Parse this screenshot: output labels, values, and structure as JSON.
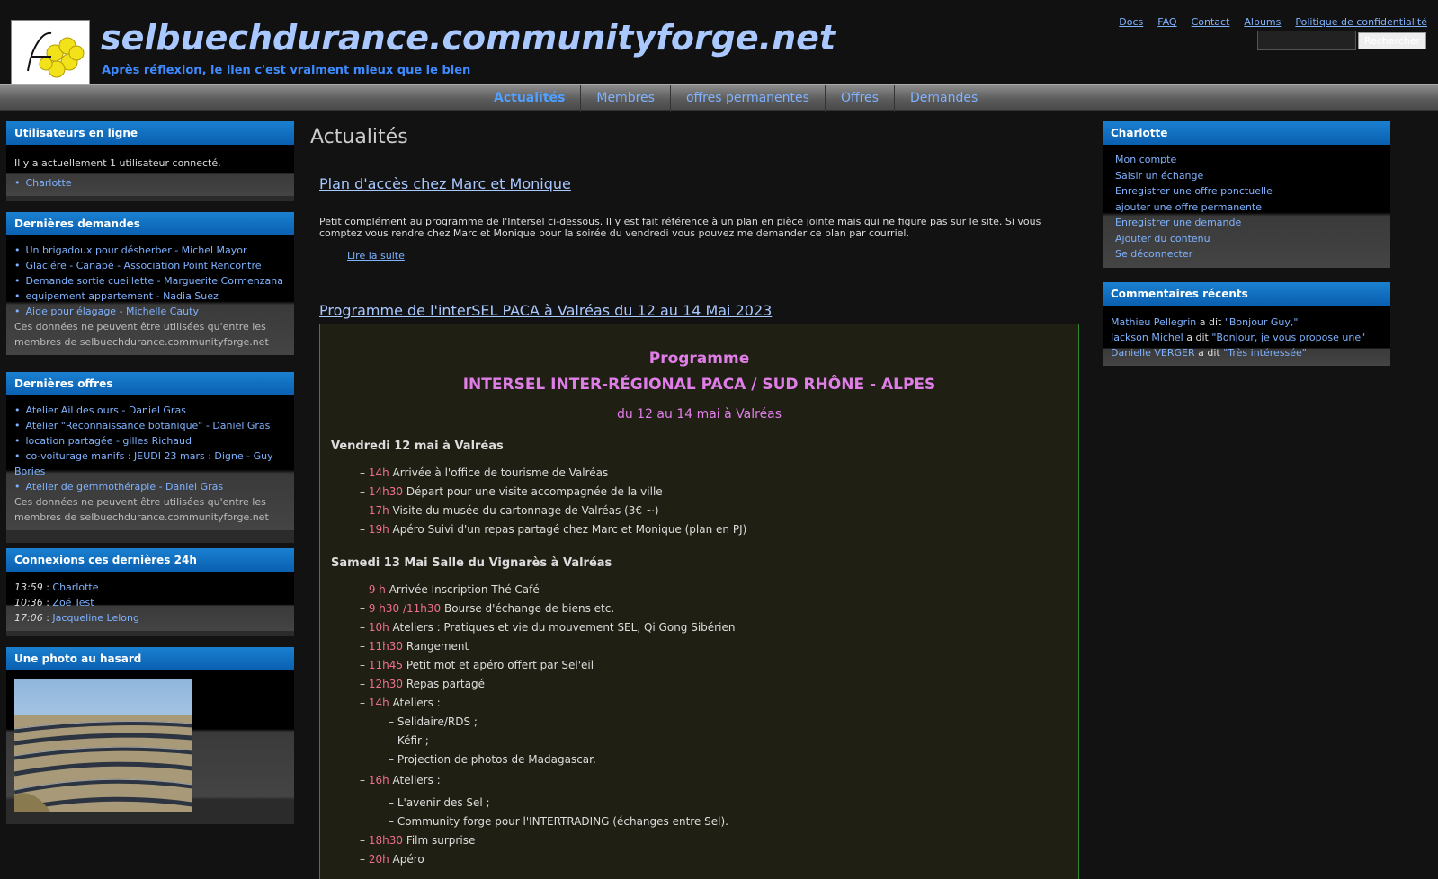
{
  "header": {
    "site_name": "selbuechdurance.communityforge.net",
    "slogan": "Après réflexion, le lien c'est vraiment mieux que le bien",
    "top_links": [
      "Docs",
      "FAQ",
      "Contact",
      "Albums",
      "Politique de confidentialité"
    ],
    "search_button": "Rechercher",
    "search_value": ""
  },
  "nav": {
    "items": [
      "Actualités",
      "Membres",
      "offres permanentes",
      "Offres",
      "Demandes"
    ],
    "active": "Actualités"
  },
  "left": {
    "online": {
      "title": "Utilisateurs en ligne",
      "text": "Il y a actuellement 1 utilisateur connecté.",
      "users": [
        "Charlotte"
      ]
    },
    "demands": {
      "title": "Dernières demandes",
      "items": [
        "Un brigadoux pour désherber - Michel Mayor",
        "Glaciére - Canapé - Association Point Rencontre",
        "Demande sortie cueillette - Marguerite Cormenzana",
        "equipement appartement - Nadia Suez",
        "Aide pour élagage - Michelle Cauty"
      ],
      "note": "Ces données ne peuvent être utilisées qu'entre les membres de selbuechdurance.communityforge.net"
    },
    "offers": {
      "title": "Dernières offres",
      "items": [
        "Atelier Ail des ours - Daniel Gras",
        "Atelier \"Reconnaissance botanique\" - Daniel Gras",
        "location partagée - gilles Richaud",
        "co-voiturage manifs : JEUDI 23 mars : Digne - Guy Bories",
        "Atelier de gemmothérapie - Daniel Gras"
      ],
      "note": "Ces données ne peuvent être utilisées qu'entre les membres de selbuechdurance.communityforge.net"
    },
    "connections": {
      "title": "Connexions ces dernières 24h",
      "items": [
        {
          "time": "13:59",
          "name": "Charlotte"
        },
        {
          "time": "10:36",
          "name": "Zoé Test"
        },
        {
          "time": "17:06",
          "name": "Jacqueline Lelong"
        }
      ]
    },
    "photo": {
      "title": "Une photo au hasard"
    }
  },
  "main": {
    "page_title": "Actualités",
    "node1": {
      "title": "Plan d'accès chez Marc et Monique",
      "teaser": "Petit complément au programme de l'Intersel ci-dessous. Il y est fait référence à un plan en pièce jointe mais qui ne figure pas sur le site. Si vous comptez vous rendre chez Marc et Monique pour la soirée du vendredi vous pouvez me demander ce plan par courriel.",
      "read_more": "Lire la suite"
    },
    "node2": {
      "title": "Programme de l'interSEL PACA à Valréas du 12 au 14 Mai 2023"
    },
    "programme": {
      "h1": "Programme",
      "h2": "INTERSEL INTER-RÉGIONAL PACA / SUD RHÔNE - ALPES",
      "h3": "du 12 au 14 mai à Valréas",
      "day1": {
        "title": "Vendredi 12 mai à Valréas",
        "items": [
          {
            "t": "14h",
            "d": "Arrivée à l'office de tourisme de Valréas"
          },
          {
            "t": "14h30",
            "d": "Départ pour une visite accompagnée de la ville"
          },
          {
            "t": "17h",
            "d": "Visite du musée du cartonnage de Valréas (3€ ~)"
          },
          {
            "t": "19h",
            "d": "Apéro Suivi d'un repas partagé chez Marc et Monique (plan en PJ)"
          }
        ]
      },
      "day2": {
        "title": "Samedi 13 Mai Salle du Vignarès à Valréas",
        "items": [
          {
            "t": "9 h",
            "d": "Arrivée Inscription Thé Café"
          },
          {
            "t": "9 h30 /11h30",
            "d": "Bourse d'échange de biens etc."
          },
          {
            "t": "10h",
            "d": "Ateliers : Pratiques et vie du mouvement SEL, Qi Gong Sibérien"
          },
          {
            "t": "11h30",
            "d": "Rangement"
          },
          {
            "t": "11h45",
            "d": "Petit mot et apéro offert par Sel'eil"
          },
          {
            "t": "12h30",
            "d": "Repas partagé"
          },
          {
            "t": "14h",
            "d": "Ateliers :"
          }
        ],
        "sub14": [
          "Selidaire/RDS ;",
          "Kéfir ;",
          "Projection de photos de Madagascar."
        ],
        "item16": {
          "t": "16h",
          "d": "Ateliers :"
        },
        "sub16": [
          "L'avenir des Sel ;",
          "Community forge pour l'INTERTRADING (échanges entre Sel)."
        ],
        "tail": [
          {
            "t": "18h30",
            "d": "Film surprise"
          },
          {
            "t": "20h",
            "d": "Apéro"
          }
        ]
      }
    }
  },
  "right": {
    "user": {
      "title": "Charlotte",
      "links": [
        "Mon compte",
        "Saisir un échange",
        "Enregistrer une offre ponctuelle",
        "ajouter une offre permanente",
        "Enregistrer une demande",
        "Ajouter du contenu",
        "Se déconnecter"
      ]
    },
    "comments": {
      "title": "Commentaires récents",
      "items": [
        {
          "who": "Mathieu Pellegrin",
          "mid": " a dit ",
          "what": "\"Bonjour Guy,\""
        },
        {
          "who": "Jackson Michel",
          "mid": " a dit ",
          "what": "\"Bonjour, je vous propose une\""
        },
        {
          "who": "Danielle VERGER",
          "mid": " a dit ",
          "what": "\"Très intéressée\""
        }
      ]
    }
  },
  "colors": {
    "accent": "#0a6cc8",
    "link": "#7fb2ff",
    "highlight": "#e07ee8",
    "time": "#f07090"
  }
}
